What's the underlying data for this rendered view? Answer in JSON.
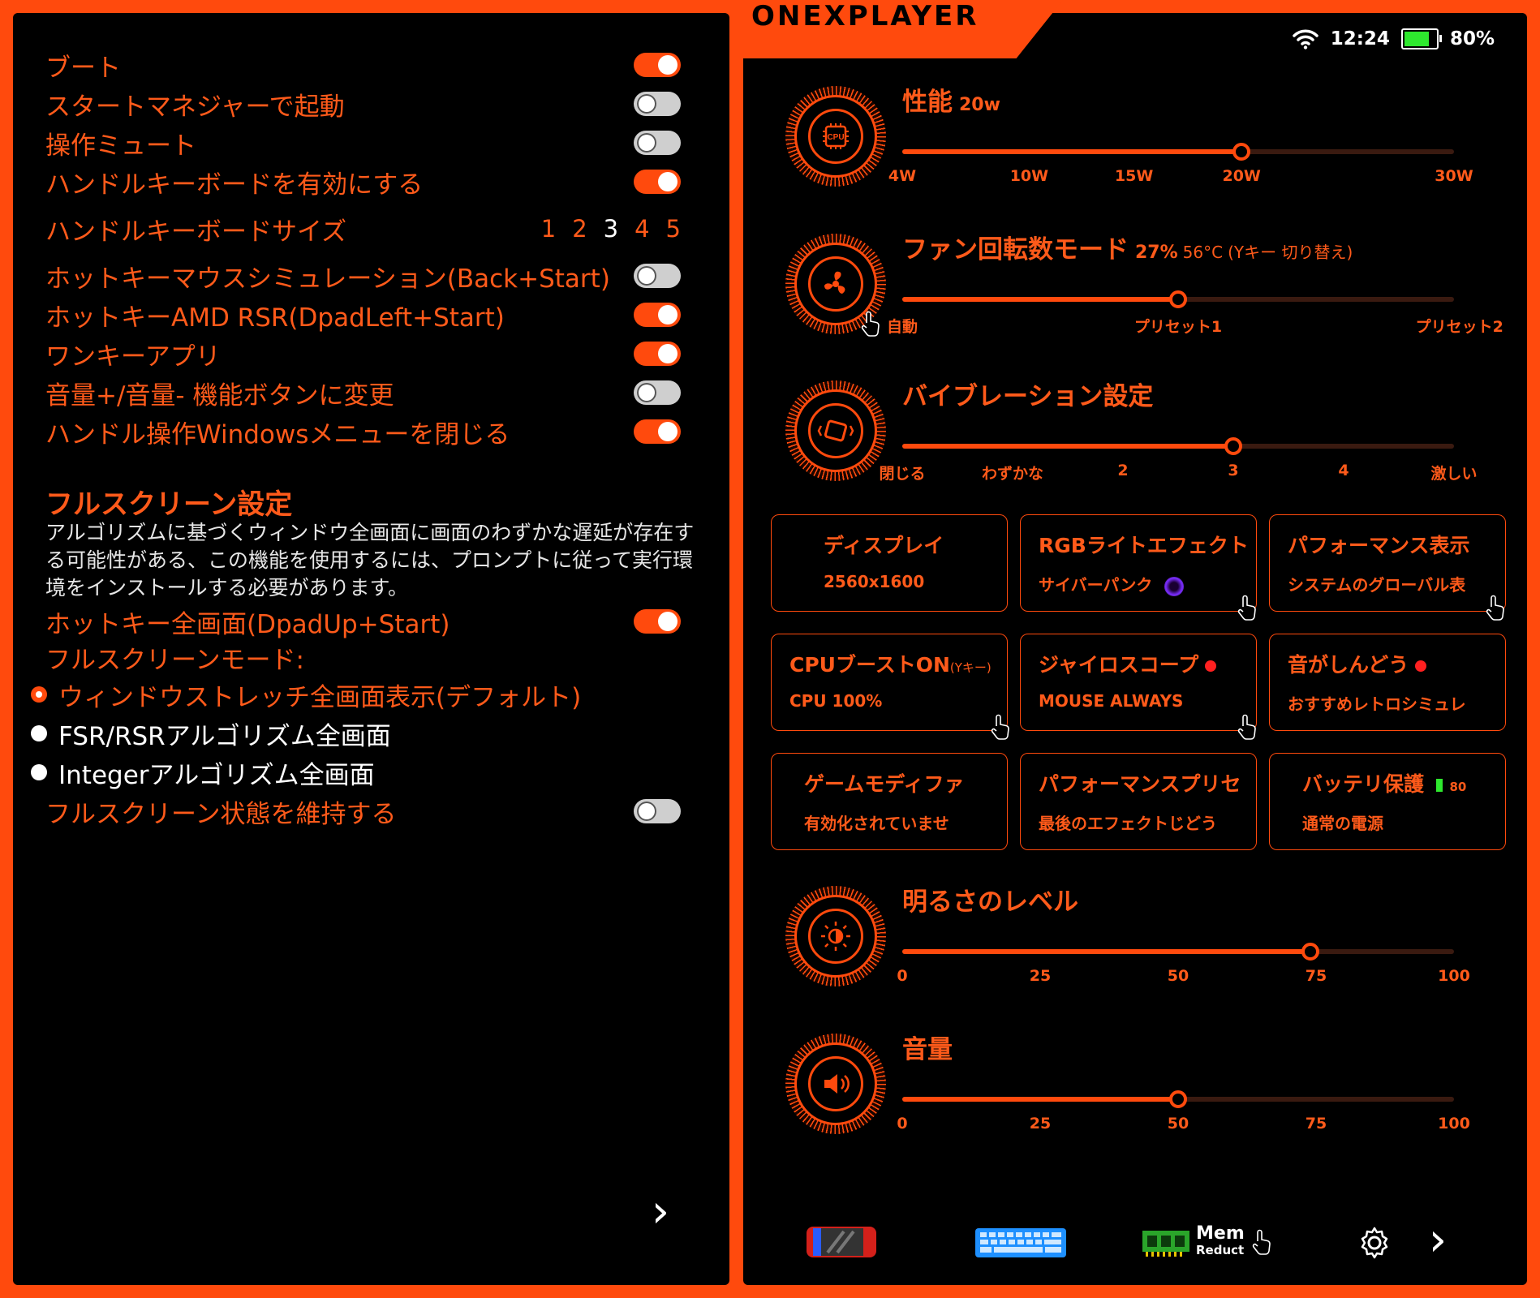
{
  "left": {
    "toggles_top": [
      {
        "label": "ブート",
        "on": true,
        "focused": true
      },
      {
        "label": "スタートマネジャーで起動",
        "on": false
      },
      {
        "label": "操作ミュート",
        "on": false
      },
      {
        "label": "ハンドルキーボードを有効にする",
        "on": true
      }
    ],
    "keyboard_size": {
      "label": "ハンドルキーボードサイズ",
      "options": [
        "1",
        "2",
        "3",
        "4",
        "5"
      ],
      "selected": "3"
    },
    "toggles_mid": [
      {
        "label": "ホットキーマウスシミュレーション(Back+Start)",
        "on": false
      },
      {
        "label": "ホットキーAMD RSR(DpadLeft+Start)",
        "on": true
      },
      {
        "label": "ワンキーアプリ",
        "on": true
      },
      {
        "label": "音量+/音量- 機能ボタンに変更",
        "on": false
      },
      {
        "label": "ハンドル操作Windowsメニューを閉じる",
        "on": true
      }
    ],
    "fullscreen": {
      "title": "フルスクリーン設定",
      "description": "アルゴリズムに基づくウィンドウ全画面に画面のわずかな遅延が存在する可能性がある、この機能を使用するには、プロンプトに従って実行環境をインストールする必要があります。",
      "hotkey": {
        "label": "ホットキー全画面(DpadUp+Start)",
        "on": true
      },
      "mode_label": "フルスクリーンモード:",
      "modes": [
        {
          "label": "ウィンドウストレッチ全画面表示(デフォルト)",
          "selected": true
        },
        {
          "label": "FSR/RSRアルゴリズム全画面",
          "selected": false
        },
        {
          "label": "Integerアルゴリズム全画面",
          "selected": false
        }
      ],
      "keep": {
        "label": "フルスクリーン状態を維持する",
        "on": false
      }
    },
    "next_glyph": "›"
  },
  "right": {
    "brand": "ONEXPLAYER",
    "status": {
      "time": "12:24",
      "battery": "80%",
      "battery_level": 0.8
    },
    "performance": {
      "title": "性能",
      "value": "20w",
      "ticks": [
        {
          "label": "4W",
          "pos": 0
        },
        {
          "label": "10W",
          "pos": 0.23
        },
        {
          "label": "15W",
          "pos": 0.42
        },
        {
          "label": "20W",
          "pos": 0.615
        },
        {
          "label": "30W",
          "pos": 1
        }
      ],
      "level": 0.615
    },
    "fan": {
      "title": "ファン回転数モード",
      "value": "27%",
      "temp": "56°C",
      "note": "(Yキー 切り替え)",
      "ticks": [
        {
          "label": "自動",
          "pos": 0
        },
        {
          "label": "プリセット1",
          "pos": 0.5
        },
        {
          "label": "プリセット2",
          "pos": 1.01
        }
      ],
      "level": 0.5
    },
    "vibration": {
      "title": "バイブレーション設定",
      "ticks": [
        {
          "label": "閉じる",
          "pos": 0
        },
        {
          "label": "わずかな",
          "pos": 0.2
        },
        {
          "label": "2",
          "pos": 0.4
        },
        {
          "label": "3",
          "pos": 0.6
        },
        {
          "label": "4",
          "pos": 0.8
        },
        {
          "label": "激しい",
          "pos": 1
        }
      ],
      "level": 0.6
    },
    "tiles": [
      {
        "title": "ディスプレイ",
        "sub": "2560x1600"
      },
      {
        "title": "RGBライトエフェクト",
        "sub": "サイバーパンク"
      },
      {
        "title": "パフォーマンス表示",
        "sub": "システムのグローバル表"
      },
      {
        "title": "CPUブーストON",
        "title_small": "(Yキー)",
        "sub": "CPU 100%"
      },
      {
        "title": "ジャイロスコープ",
        "sub": "MOUSE ALWAYS"
      },
      {
        "title": "音がしんどう",
        "sub": "おすすめレトロシミュレ"
      },
      {
        "title": "ゲームモディファ",
        "sub": "有効化されていませ"
      },
      {
        "title": "パフォーマンスプリセ",
        "sub": "最後のエフェクトじどう"
      },
      {
        "title": "バッテリ保護",
        "title_small": "80",
        "sub": "通常の電源"
      }
    ],
    "brightness": {
      "title": "明るさのレベル",
      "ticks": [
        {
          "label": "0",
          "pos": 0
        },
        {
          "label": "25",
          "pos": 0.25
        },
        {
          "label": "50",
          "pos": 0.5
        },
        {
          "label": "75",
          "pos": 0.75
        },
        {
          "label": "100",
          "pos": 1
        }
      ],
      "level": 0.74
    },
    "volume": {
      "title": "音量",
      "ticks": [
        {
          "label": "0",
          "pos": 0
        },
        {
          "label": "25",
          "pos": 0.25
        },
        {
          "label": "50",
          "pos": 0.5
        },
        {
          "label": "75",
          "pos": 0.75
        },
        {
          "label": "100",
          "pos": 1
        }
      ],
      "level": 0.5
    },
    "bottom": {
      "mem_label": "Mem",
      "mem_sub": "Reduct",
      "next_glyph": "›"
    },
    "colors": {
      "accent": "#ff4a0d",
      "panel": "#000000"
    }
  }
}
